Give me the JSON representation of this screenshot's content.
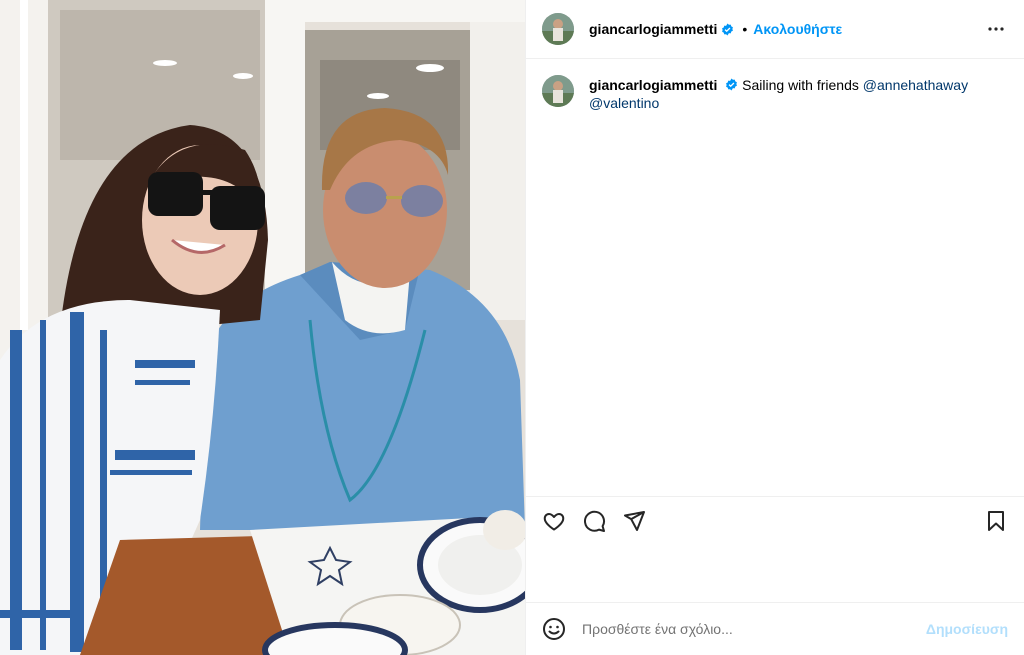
{
  "post": {
    "username": "giancarlogiammetti",
    "verified": true,
    "follow_label": "Ακολουθήστε",
    "separator": "•",
    "caption_text": "Sailing with friends ",
    "mention_1": "@annehathaway",
    "mention_2": "@valentino",
    "icons": {
      "more": "more-options-icon",
      "like": "heart-icon",
      "comment": "comment-bubble-icon",
      "share": "share-paper-plane-icon",
      "save": "bookmark-icon",
      "emoji": "emoji-icon",
      "verified": "verified-badge-icon"
    }
  },
  "composer": {
    "placeholder": "Προσθέστε ένα σχόλιο...",
    "post_label": "Δημοσίευση"
  },
  "colors": {
    "link_blue": "#0095f6",
    "mention_blue": "#00376b",
    "disabled_blue": "#b2dffc"
  }
}
